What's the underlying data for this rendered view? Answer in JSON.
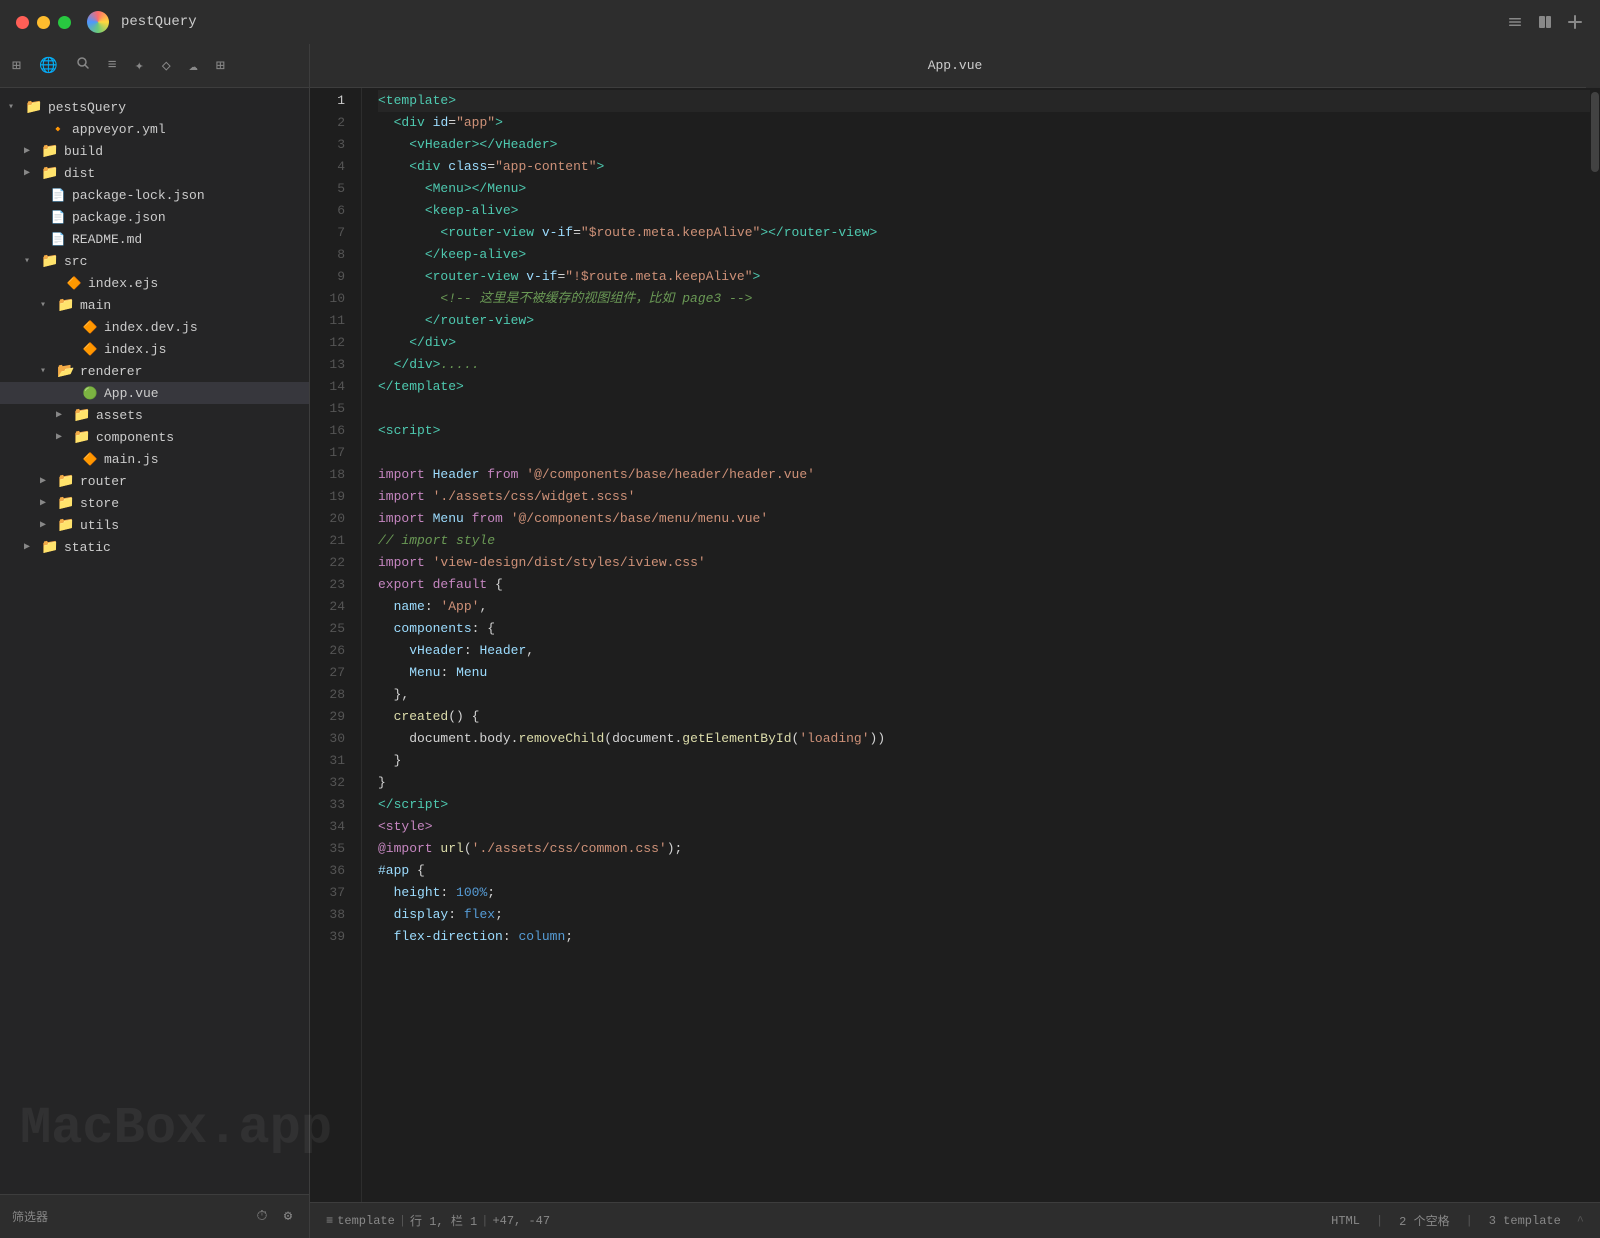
{
  "titlebar": {
    "app_name": "pestQuery",
    "tab_title": "App.vue"
  },
  "sidebar": {
    "root_label": "pestsQuery",
    "footer_placeholder": "筛选器",
    "items": [
      {
        "id": "pestsQuery",
        "label": "pestsQuery",
        "type": "folder",
        "depth": 0,
        "expanded": true,
        "arrow": "▾"
      },
      {
        "id": "appveyor.yml",
        "label": "appveyor.yml",
        "type": "file-yml",
        "depth": 1
      },
      {
        "id": "build",
        "label": "build",
        "type": "folder",
        "depth": 1,
        "expanded": false,
        "arrow": "▶"
      },
      {
        "id": "dist",
        "label": "dist",
        "type": "folder",
        "depth": 1,
        "expanded": false,
        "arrow": "▶"
      },
      {
        "id": "package-lock.json",
        "label": "package-lock.json",
        "type": "file-json",
        "depth": 1
      },
      {
        "id": "package.json",
        "label": "package.json",
        "type": "file-json",
        "depth": 1
      },
      {
        "id": "README.md",
        "label": "README.md",
        "type": "file-md",
        "depth": 1
      },
      {
        "id": "src",
        "label": "src",
        "type": "folder",
        "depth": 1,
        "expanded": true,
        "arrow": "▾"
      },
      {
        "id": "index.ejs",
        "label": "index.ejs",
        "type": "file-js",
        "depth": 2
      },
      {
        "id": "main",
        "label": "main",
        "type": "folder",
        "depth": 2,
        "expanded": true,
        "arrow": "▾"
      },
      {
        "id": "index.dev.js",
        "label": "index.dev.js",
        "type": "file-js",
        "depth": 3
      },
      {
        "id": "index.js2",
        "label": "index.js",
        "type": "file-js",
        "depth": 3
      },
      {
        "id": "renderer",
        "label": "renderer",
        "type": "folder-blue",
        "depth": 2,
        "expanded": true,
        "arrow": "▾"
      },
      {
        "id": "App.vue",
        "label": "App.vue",
        "type": "file-vue",
        "depth": 3,
        "active": true
      },
      {
        "id": "assets",
        "label": "assets",
        "type": "folder",
        "depth": 3,
        "expanded": false,
        "arrow": "▶"
      },
      {
        "id": "components",
        "label": "components",
        "type": "folder",
        "depth": 3,
        "expanded": false,
        "arrow": "▶"
      },
      {
        "id": "main.js",
        "label": "main.js",
        "type": "file-js",
        "depth": 3
      },
      {
        "id": "router",
        "label": "router",
        "type": "folder",
        "depth": 2,
        "expanded": false,
        "arrow": "▶"
      },
      {
        "id": "store",
        "label": "store",
        "type": "folder",
        "depth": 2,
        "expanded": false,
        "arrow": "▶"
      },
      {
        "id": "utils",
        "label": "utils",
        "type": "folder",
        "depth": 2,
        "expanded": false,
        "arrow": "▶"
      },
      {
        "id": "static",
        "label": "static",
        "type": "folder",
        "depth": 1,
        "expanded": false,
        "arrow": "▶"
      }
    ]
  },
  "editor": {
    "filename": "App.vue",
    "status": {
      "symbol_label": "≡ template",
      "position": "行 1, 栏 1",
      "cursor": "+47, -47",
      "language": "HTML",
      "indent": "2 个空格",
      "template_count": "3 template"
    }
  },
  "watermark": "MacBox.app",
  "code_lines": [
    {
      "num": 1,
      "content": "<span class='c-tag'>&lt;template&gt;</span>"
    },
    {
      "num": 2,
      "content": "  <span class='c-tag'>&lt;div</span> <span class='c-attr'>id</span><span class='c-punct'>=</span><span class='c-string'>\"app\"</span><span class='c-tag'>&gt;</span>"
    },
    {
      "num": 3,
      "content": "    <span class='c-tag'>&lt;vHeader&gt;&lt;/vHeader&gt;</span>"
    },
    {
      "num": 4,
      "content": "    <span class='c-tag'>&lt;div</span> <span class='c-attr'>class</span><span class='c-punct'>=</span><span class='c-string'>\"app-content\"</span><span class='c-tag'>&gt;</span>"
    },
    {
      "num": 5,
      "content": "      <span class='c-tag'>&lt;Menu&gt;&lt;/Menu&gt;</span>"
    },
    {
      "num": 6,
      "content": "      <span class='c-tag'>&lt;keep-alive&gt;</span>"
    },
    {
      "num": 7,
      "content": "        <span class='c-tag'>&lt;router-view</span> <span class='c-attr'>v-if</span><span class='c-punct'>=</span><span class='c-string'>\"$route.meta.keepAlive\"</span><span class='c-tag'>&gt;&lt;/router-view&gt;</span>"
    },
    {
      "num": 8,
      "content": "      <span class='c-tag'>&lt;/keep-alive&gt;</span>"
    },
    {
      "num": 9,
      "content": "      <span class='c-tag'>&lt;router-view</span> <span class='c-attr'>v-if</span><span class='c-punct'>=</span><span class='c-string'>\"!$route.meta.keepAlive\"</span><span class='c-tag'>&gt;</span>"
    },
    {
      "num": 10,
      "content": "        <span class='c-comment'>&lt;!-- 这里是不被缓存的视图组件，比如 page3 --&gt;</span>"
    },
    {
      "num": 11,
      "content": "      <span class='c-tag'>&lt;/router-view&gt;</span>"
    },
    {
      "num": 12,
      "content": "    <span class='c-tag'>&lt;/div&gt;</span>"
    },
    {
      "num": 13,
      "content": "  <span class='c-tag'>&lt;/div&gt;</span><span class='c-comment'>.....</span>"
    },
    {
      "num": 14,
      "content": "<span class='c-tag'>&lt;/template&gt;</span>"
    },
    {
      "num": 15,
      "content": ""
    },
    {
      "num": 16,
      "content": "<span class='c-tag'>&lt;script&gt;</span>"
    },
    {
      "num": 17,
      "content": ""
    },
    {
      "num": 18,
      "content": "<span class='c-import'>import</span> <span class='c-module'>Header</span> <span class='c-from'>from</span> <span class='c-path'>'@/components/base/header/header.vue'</span>"
    },
    {
      "num": 19,
      "content": "<span class='c-import'>import</span> <span class='c-path'>'./assets/css/widget.scss'</span>"
    },
    {
      "num": 20,
      "content": "<span class='c-import'>import</span> <span class='c-module'>Menu</span> <span class='c-from'>from</span> <span class='c-path'>'@/components/base/menu/menu.vue'</span>"
    },
    {
      "num": 21,
      "content": "<span class='c-comment'>// import style</span>"
    },
    {
      "num": 22,
      "content": "<span class='c-import'>import</span> <span class='c-path'>'view-design/dist/styles/iview.css'</span>"
    },
    {
      "num": 23,
      "content": "<span class='c-keyword'>export default</span> <span class='c-punct'>{</span>"
    },
    {
      "num": 24,
      "content": "  <span class='c-prop'>name</span><span class='c-punct'>:</span> <span class='c-string'>'App'</span><span class='c-punct'>,</span>"
    },
    {
      "num": 25,
      "content": "  <span class='c-prop'>components</span><span class='c-punct'>:</span> <span class='c-punct'>{</span>"
    },
    {
      "num": 26,
      "content": "    <span class='c-prop'>vHeader</span><span class='c-punct'>:</span> <span class='c-module'>Header</span><span class='c-punct'>,</span>"
    },
    {
      "num": 27,
      "content": "    <span class='c-prop'>Menu</span><span class='c-punct'>:</span> <span class='c-module'>Menu</span>"
    },
    {
      "num": 28,
      "content": "  <span class='c-punct'>},</span>"
    },
    {
      "num": 29,
      "content": "  <span class='c-func'>created</span><span class='c-punct'>()</span> <span class='c-punct'>{</span>"
    },
    {
      "num": 30,
      "content": "    <span class='c-plain'>document.body.</span><span class='c-func'>removeChild</span><span class='c-punct'>(</span><span class='c-plain'>document.</span><span class='c-func'>getElementById</span><span class='c-punct'>(</span><span class='c-string'>'loading'</span><span class='c-punct'>))</span>"
    },
    {
      "num": 31,
      "content": "  <span class='c-punct'>}</span>"
    },
    {
      "num": 32,
      "content": "<span class='c-punct'>}</span>"
    },
    {
      "num": 33,
      "content": "<span class='c-tag'>&lt;/script&gt;</span>"
    },
    {
      "num": 34,
      "content": "<span class='c-style-tag'>&lt;style&gt;</span>"
    },
    {
      "num": 35,
      "content": "<span class='c-at'>@import</span> <span class='c-func'>url</span><span class='c-punct'>(</span><span class='c-string'>'./assets/css/common.css'</span><span class='c-punct'>);</span>"
    },
    {
      "num": 36,
      "content": "<span class='c-attr'>#app</span> <span class='c-punct'>{</span>"
    },
    {
      "num": 37,
      "content": "  <span class='c-prop'>height</span><span class='c-punct'>:</span> <span class='c-value'>100%</span><span class='c-punct'>;</span>"
    },
    {
      "num": 38,
      "content": "  <span class='c-prop'>display</span><span class='c-punct'>:</span> <span class='c-value'>flex</span><span class='c-punct'>;</span>"
    },
    {
      "num": 39,
      "content": "  <span class='c-prop'>flex-direction</span><span class='c-punct'>:</span> <span class='c-value'>column</span><span class='c-punct'>;</span>"
    }
  ]
}
